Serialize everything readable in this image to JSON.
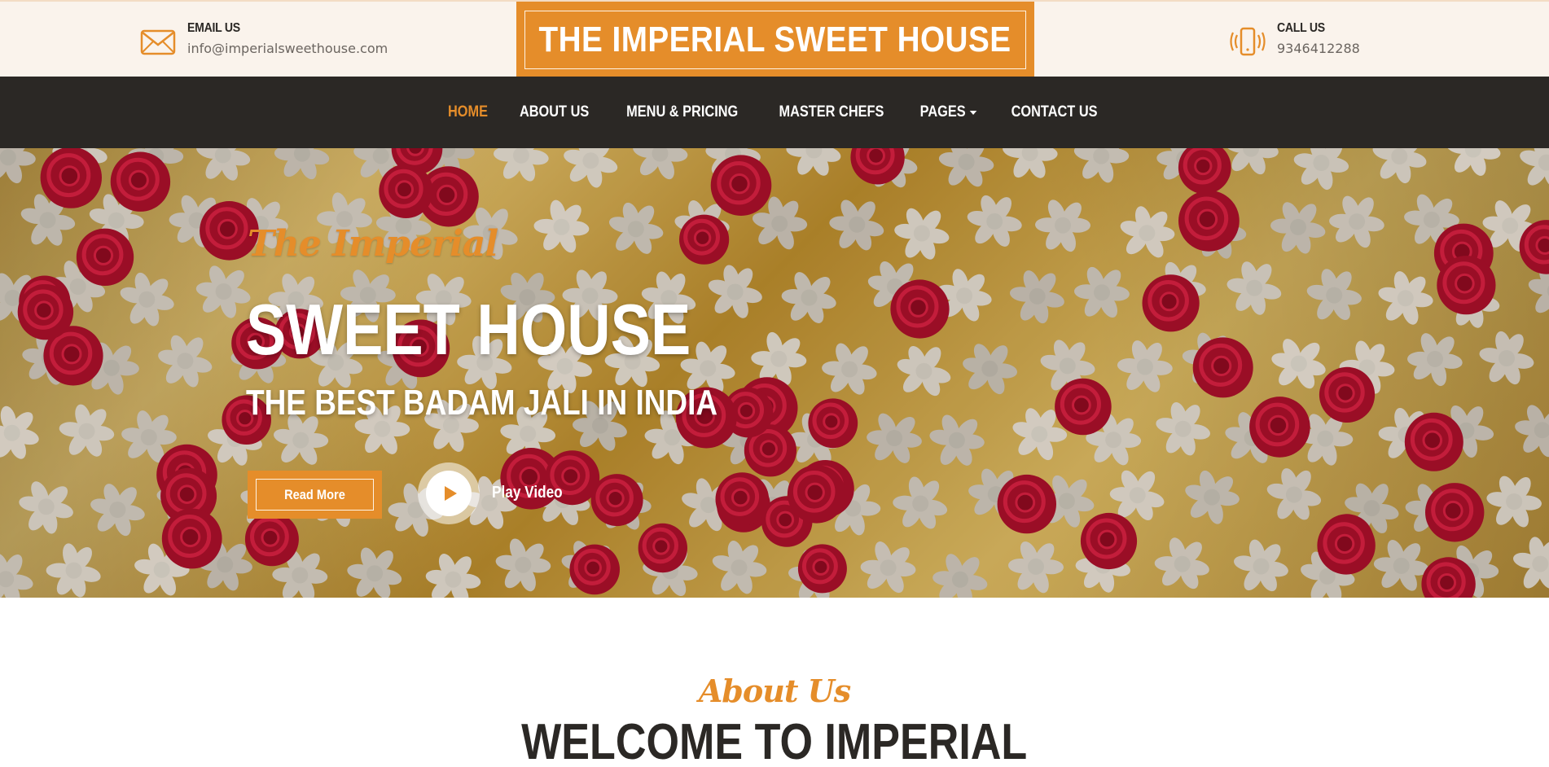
{
  "topbar": {
    "email": {
      "icon": "envelope-icon",
      "label": "EMAIL US",
      "value": "info@imperialsweethouse.com"
    },
    "phone": {
      "icon": "phone-vibrate-icon",
      "label": "CALL US",
      "value": "9346412288"
    },
    "brand": "THE IMPERIAL SWEET HOUSE"
  },
  "nav": {
    "items": [
      {
        "label": "HOME",
        "active": true
      },
      {
        "label": "ABOUT US",
        "active": false
      },
      {
        "label": "MENU & PRICING",
        "active": false
      },
      {
        "label": "MASTER CHEFS",
        "active": false
      },
      {
        "label": "PAGES",
        "active": false,
        "dropdown": true
      },
      {
        "label": "CONTACT US",
        "active": false
      }
    ]
  },
  "hero": {
    "script": "The Imperial",
    "title": "SWEET HOUSE",
    "subtitle": "THE BEST BADAM JALI IN INDIA",
    "read_more": "Read More",
    "play_video": "Play Video"
  },
  "about": {
    "script": "About Us",
    "title": "WELCOME TO IMPERIAL"
  },
  "colors": {
    "accent": "#e58d2a",
    "dark": "#2b2825",
    "topbar_bg": "#faf3ec"
  }
}
